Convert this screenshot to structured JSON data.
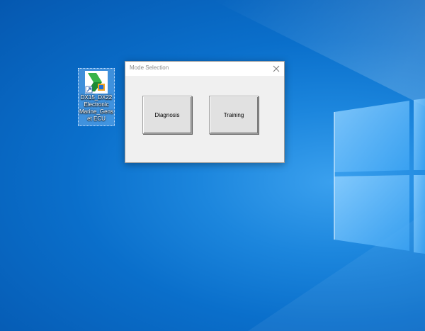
{
  "desktop": {
    "icon": {
      "name": "DX15_DX22 Electronic Marine_Genset ECU",
      "label_lines": "DX15_DX22\nElectronic\nMarine_Gens\net ECU"
    }
  },
  "dialog": {
    "title": "Mode Selection",
    "buttons": {
      "diagnosis": "Diagnosis",
      "training": "Training"
    }
  },
  "colors": {
    "desktop_blue": "#0a6fcb",
    "window_light": "#e6f3ff"
  }
}
